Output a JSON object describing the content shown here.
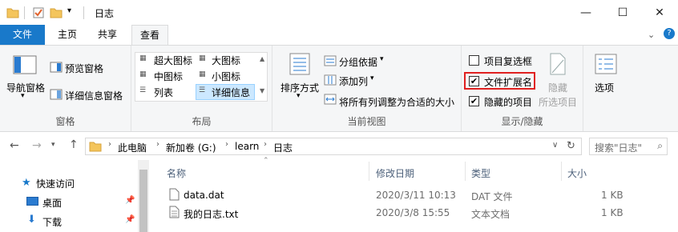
{
  "title": "日志",
  "tabs": [
    "文件",
    "主页",
    "共享",
    "查看"
  ],
  "ribbon": {
    "panes": {
      "nav_pane": "导航窗格",
      "preview": "预览窗格",
      "details_pane": "详细信息窗格",
      "label": "窗格"
    },
    "layout": {
      "xlarge": "超大图标",
      "large": "大图标",
      "medium": "中图标",
      "small": "小图标",
      "list": "列表",
      "details": "详细信息",
      "label": "布局"
    },
    "current_view": {
      "sort": "排序方式",
      "group": "分组依据",
      "add_col": "添加列",
      "fit_cols": "将所有列调整为合适的大小",
      "label": "当前视图"
    },
    "show_hide": {
      "item_check": "项目复选框",
      "file_ext": "文件扩展名",
      "hidden": "隐藏的项目",
      "hide_sel_1": "隐藏",
      "hide_sel_2": "所选项目",
      "label": "显示/隐藏"
    },
    "options": "选项"
  },
  "checks": {
    "item_check": false,
    "file_ext": true,
    "hidden": true
  },
  "address": {
    "path": [
      "此电脑",
      "新加卷 (G:)",
      "learn",
      "日志"
    ],
    "search_placeholder": "搜索\"日志\""
  },
  "nav": {
    "quick_access": "快速访问",
    "desktop": "桌面",
    "downloads": "下载"
  },
  "columns": {
    "name": "名称",
    "date": "修改日期",
    "type": "类型",
    "size": "大小"
  },
  "files": [
    {
      "name": "data.dat",
      "date": "2020/3/11 10:13",
      "type": "DAT 文件",
      "size": "1 KB"
    },
    {
      "name": "我的日志.txt",
      "date": "2020/3/8 15:55",
      "type": "文本文档",
      "size": "1 KB"
    }
  ],
  "colors": {
    "accent": "#1979ca",
    "highlight": "#e02020"
  }
}
